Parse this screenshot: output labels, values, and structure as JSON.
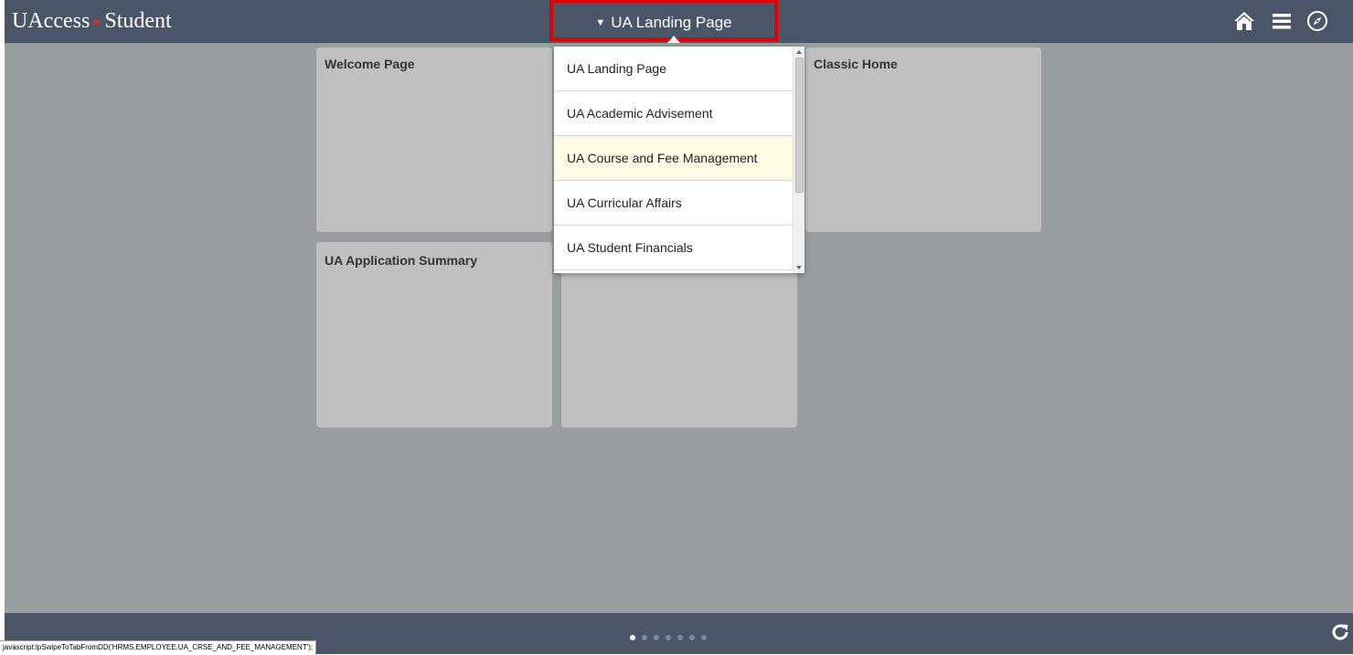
{
  "header": {
    "brand_primary": "UAccess",
    "brand_secondary": "Student",
    "brand_separator": "▸",
    "page_selector_label": "UA Landing Page",
    "icons": [
      "home-icon",
      "menu-icon",
      "navbar-compass-icon"
    ]
  },
  "dropdown": {
    "items": [
      {
        "label": "UA Landing Page"
      },
      {
        "label": "UA Academic Advisement"
      },
      {
        "label": "UA Course and Fee Management"
      },
      {
        "label": "UA Curricular Affairs"
      },
      {
        "label": "UA Student Financials"
      }
    ],
    "highlighted_index": 2
  },
  "tiles": [
    {
      "title": "Welcome Page"
    },
    {
      "title": "Classic Home"
    },
    {
      "title": "UA Application Summary"
    },
    {
      "title": ""
    }
  ],
  "footer": {
    "page_count": 7,
    "active_page": 1,
    "status_url": "javascript:lpSwipeToTabFromDD('HRMS.EMPLOYEE.UA_CRSE_AND_FEE_MANAGEMENT');"
  },
  "colors": {
    "header_bg": "#4a5668",
    "content_bg": "#9a9e9f",
    "tile_bg": "#c0c0c0",
    "highlight": "#fcfce4",
    "selector_border": "#e00000"
  }
}
